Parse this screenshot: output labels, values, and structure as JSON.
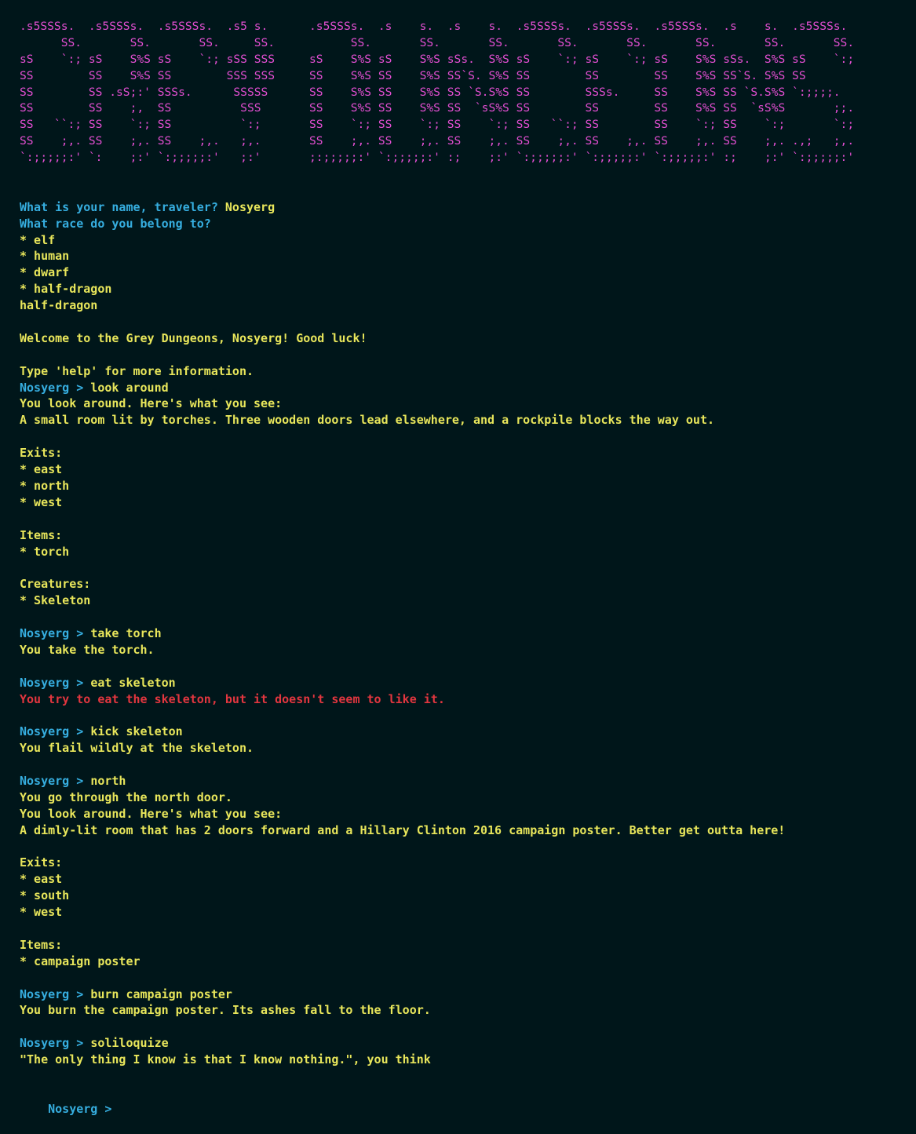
{
  "colors": {
    "background": "#00161a",
    "banner": "#e44fd3",
    "prompt": "#36aee0",
    "text": "#e8e65b",
    "error": "#e2363f"
  },
  "banner": [
    ".s5SSSs.  .s5SSSs.  .s5SSSs.  .s5 s.      .s5SSSs.  .s    s.  .s    s.  .s5SSSs.  .s5SSSs.  .s5SSSs.  .s    s.  .s5SSSs.",
    "      SS.       SS.       SS.     SS.           SS.       SS.       SS.       SS.       SS.       SS.       SS.       SS.",
    "sS    `:; sS    S%S sS    `:; sSS SSS     sS    S%S sS    S%S sSs.  S%S sS    `:; sS    `:; sS    S%S sSs.  S%S sS    `:;",
    "SS        SS    S%S SS        SSS SSS     SS    S%S SS    S%S SS`S. S%S SS        SS        SS    S%S SS`S. S%S SS",
    "SS        SS .sS;:' SSSs.      SSSSS      SS    S%S SS    S%S SS `S.S%S SS        SSSs.     SS    S%S SS `S.S%S `:;;;;.",
    "SS        SS    ;,  SS          SSS       SS    S%S SS    S%S SS  `sS%S SS        SS        SS    S%S SS  `sS%S       ;;.",
    "SS   ``:; SS    `:; SS          `:;       SS    `:; SS    `:; SS    `:; SS   ``:; SS        SS    `:; SS    `:;       `:;",
    "SS    ;,. SS    ;,. SS    ;,.   ;,.       SS    ;,. SS    ;,. SS    ;,. SS    ;,. SS    ;,. SS    ;,. SS    ;,. .,;   ;,.",
    "`:;;;;;:' `:    ;:' `:;;;;;:'   ;:'       ;:;;;;;:' `:;;;;;:' :;    ;:' `:;;;;;:' `:;;;;;:' `:;;;;;:' :;    ;:' `:;;;;;:'"
  ],
  "session": [
    {
      "segments": [
        {
          "c": "q",
          "t": "What is your name, traveler? "
        },
        {
          "c": "a",
          "t": "Nosyerg"
        }
      ]
    },
    {
      "segments": [
        {
          "c": "q",
          "t": "What race do you belong to?"
        }
      ]
    },
    {
      "segments": [
        {
          "c": "a",
          "t": "* elf"
        }
      ]
    },
    {
      "segments": [
        {
          "c": "a",
          "t": "* human"
        }
      ]
    },
    {
      "segments": [
        {
          "c": "a",
          "t": "* dwarf"
        }
      ]
    },
    {
      "segments": [
        {
          "c": "a",
          "t": "* half-dragon"
        }
      ]
    },
    {
      "segments": [
        {
          "c": "a",
          "t": "half-dragon"
        }
      ]
    },
    {
      "segments": []
    },
    {
      "segments": [
        {
          "c": "a",
          "t": "Welcome to the Grey Dungeons, Nosyerg! Good luck!"
        }
      ]
    },
    {
      "segments": []
    },
    {
      "segments": [
        {
          "c": "a",
          "t": "Type 'help' for more information."
        }
      ]
    },
    {
      "segments": [
        {
          "c": "prompt",
          "t": "Nosyerg > "
        },
        {
          "c": "a",
          "t": "look around"
        }
      ]
    },
    {
      "segments": [
        {
          "c": "a",
          "t": "You look around. Here's what you see:"
        }
      ]
    },
    {
      "segments": [
        {
          "c": "a",
          "t": "A small room lit by torches. Three wooden doors lead elsewhere, and a rockpile blocks the way out."
        }
      ]
    },
    {
      "segments": []
    },
    {
      "segments": [
        {
          "c": "a",
          "t": "Exits:"
        }
      ]
    },
    {
      "segments": [
        {
          "c": "a",
          "t": "* east"
        }
      ]
    },
    {
      "segments": [
        {
          "c": "a",
          "t": "* north"
        }
      ]
    },
    {
      "segments": [
        {
          "c": "a",
          "t": "* west"
        }
      ]
    },
    {
      "segments": []
    },
    {
      "segments": [
        {
          "c": "a",
          "t": "Items:"
        }
      ]
    },
    {
      "segments": [
        {
          "c": "a",
          "t": "* torch"
        }
      ]
    },
    {
      "segments": []
    },
    {
      "segments": [
        {
          "c": "a",
          "t": "Creatures:"
        }
      ]
    },
    {
      "segments": [
        {
          "c": "a",
          "t": "* Skeleton"
        }
      ]
    },
    {
      "segments": []
    },
    {
      "segments": [
        {
          "c": "prompt",
          "t": "Nosyerg > "
        },
        {
          "c": "a",
          "t": "take torch"
        }
      ]
    },
    {
      "segments": [
        {
          "c": "a",
          "t": "You take the torch."
        }
      ]
    },
    {
      "segments": []
    },
    {
      "segments": [
        {
          "c": "prompt",
          "t": "Nosyerg > "
        },
        {
          "c": "a",
          "t": "eat skeleton"
        }
      ]
    },
    {
      "segments": [
        {
          "c": "red",
          "t": "You try to eat the skeleton, but it doesn't seem to like it."
        }
      ]
    },
    {
      "segments": []
    },
    {
      "segments": [
        {
          "c": "prompt",
          "t": "Nosyerg > "
        },
        {
          "c": "a",
          "t": "kick skeleton"
        }
      ]
    },
    {
      "segments": [
        {
          "c": "a",
          "t": "You flail wildly at the skeleton."
        }
      ]
    },
    {
      "segments": []
    },
    {
      "segments": [
        {
          "c": "prompt",
          "t": "Nosyerg > "
        },
        {
          "c": "a",
          "t": "north"
        }
      ]
    },
    {
      "segments": [
        {
          "c": "a",
          "t": "You go through the north door."
        }
      ]
    },
    {
      "segments": [
        {
          "c": "a",
          "t": "You look around. Here's what you see:"
        }
      ]
    },
    {
      "segments": [
        {
          "c": "a",
          "t": "A dimly-lit room that has 2 doors forward and a Hillary Clinton 2016 campaign poster. Better get outta here!"
        }
      ]
    },
    {
      "segments": []
    },
    {
      "segments": [
        {
          "c": "a",
          "t": "Exits:"
        }
      ]
    },
    {
      "segments": [
        {
          "c": "a",
          "t": "* east"
        }
      ]
    },
    {
      "segments": [
        {
          "c": "a",
          "t": "* south"
        }
      ]
    },
    {
      "segments": [
        {
          "c": "a",
          "t": "* west"
        }
      ]
    },
    {
      "segments": []
    },
    {
      "segments": [
        {
          "c": "a",
          "t": "Items:"
        }
      ]
    },
    {
      "segments": [
        {
          "c": "a",
          "t": "* campaign poster"
        }
      ]
    },
    {
      "segments": []
    },
    {
      "segments": [
        {
          "c": "prompt",
          "t": "Nosyerg > "
        },
        {
          "c": "a",
          "t": "burn campaign poster"
        }
      ]
    },
    {
      "segments": [
        {
          "c": "a",
          "t": "You burn the campaign poster. Its ashes fall to the floor."
        }
      ]
    },
    {
      "segments": []
    },
    {
      "segments": [
        {
          "c": "prompt",
          "t": "Nosyerg > "
        },
        {
          "c": "a",
          "t": "soliloquize"
        }
      ]
    },
    {
      "segments": [
        {
          "c": "a",
          "t": "\"The only thing I know is that I know nothing.\", you think"
        }
      ]
    },
    {
      "segments": []
    }
  ],
  "input": {
    "prompt": "Nosyerg > ",
    "value": ""
  }
}
